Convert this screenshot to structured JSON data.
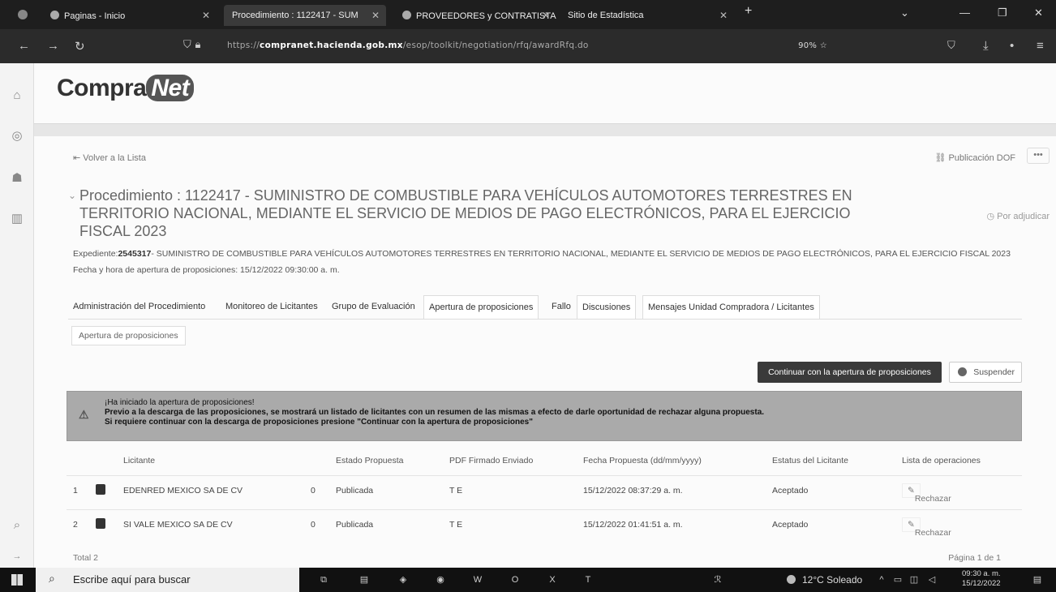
{
  "browser": {
    "tabs": [
      {
        "label": "Paginas - Inicio"
      },
      {
        "label": "Procedimiento : 1122417 - SUM"
      },
      {
        "label": "PROVEEDORES y CONTRATISTA"
      },
      {
        "label": "Sitio de Estadística"
      }
    ],
    "url_prefix": "https://",
    "url_host": "compranet.hacienda.gob.mx",
    "url_path": "/esop/toolkit/negotiation/rfq/awardRfq.do",
    "zoom": "90%"
  },
  "site": {
    "logo_main": "Compra",
    "logo_accent": "Net"
  },
  "header": {
    "back_link": "Volver a la Lista",
    "publicacion_dof": "Publicación DOF",
    "more": "•••",
    "procedure_title": "Procedimiento : 1122417 - SUMINISTRO DE COMBUSTIBLE PARA VEHÍCULOS AUTOMOTORES TERRESTRES EN TERRITORIO NACIONAL, MEDIANTE EL SERVICIO DE MEDIOS DE PAGO ELECTRÓNICOS, PARA EL EJERCICIO FISCAL 2023",
    "status": "Por adjudicar",
    "expediente_label": "Expediente:",
    "expediente_number": "2545317",
    "expediente_text": "- SUMINISTRO DE COMBUSTIBLE PARA VEHÍCULOS AUTOMOTORES TERRESTRES EN TERRITORIO NACIONAL, MEDIANTE EL SERVICIO DE MEDIOS DE PAGO ELECTRÓNICOS, PARA EL EJERCICIO FISCAL 2023",
    "fecha_apertura": "Fecha y hora de apertura de proposiciones: 15/12/2022 09:30:00 a. m."
  },
  "tabs": [
    "Administración del Procedimiento",
    "Monitoreo de Licitantes",
    "Grupo de Evaluación",
    "Apertura de proposiciones",
    "Fallo",
    "Discusiones",
    "Mensajes Unidad Compradora / Licitantes"
  ],
  "subtab": "Apertura de proposiciones",
  "actions": {
    "continue": "Continuar con la apertura de proposiciones",
    "suspend": "Suspender"
  },
  "alert": {
    "line1": "¡Ha iniciado la apertura de proposiciones!",
    "line2": "Previo a la descarga de las proposiciones, se mostrará un listado de licitantes con un resumen de las mismas a efecto de darle oportunidad de rechazar alguna propuesta.",
    "line3": "Si requiere continuar con la descarga de proposiciones presione \"Continuar con la apertura de proposiciones\""
  },
  "table": {
    "headers": {
      "licitante": "Licitante",
      "estado": "Estado Propuesta",
      "pdf": "PDF Firmado Enviado",
      "fecha": "Fecha Propuesta (dd/mm/yyyy)",
      "estatus": "Estatus del Licitante",
      "operaciones": "Lista de operaciones"
    },
    "rows": [
      {
        "n": "1",
        "licitante": "EDENRED MEXICO SA DE CV",
        "count": "0",
        "estado": "Publicada",
        "pdf": "T E",
        "fecha": "15/12/2022 08:37:29 a. m.",
        "estatus": "Aceptado",
        "op": "Rechazar"
      },
      {
        "n": "2",
        "licitante": "SI VALE MEXICO SA DE CV",
        "count": "0",
        "estado": "Publicada",
        "pdf": "T E",
        "fecha": "15/12/2022 01:41:51 a. m.",
        "estatus": "Aceptado",
        "op": "Rechazar"
      }
    ],
    "total": "Total 2",
    "pagination": "Página 1 de 1"
  },
  "taskbar": {
    "search_placeholder": "Escribe aquí para buscar",
    "weather": "12°C  Soleado",
    "time": "09:30 a. m.",
    "date": "15/12/2022"
  }
}
